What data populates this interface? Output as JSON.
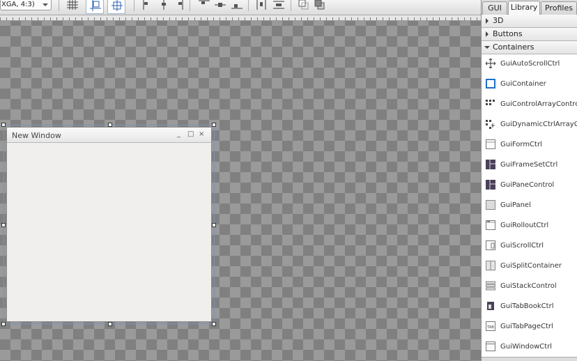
{
  "toolbar": {
    "resolution_value": "XGA, 4:3)",
    "icons": [
      "grid-icon",
      "snap-to-edges-icon",
      "snap-to-centers-icon",
      "align-left-icon",
      "align-center-horizontal-icon",
      "align-right-icon",
      "align-top-icon",
      "align-center-vertical-icon",
      "align-bottom-icon",
      "distribute-horizontal-icon",
      "distribute-vertical-icon",
      "bring-to-front-icon",
      "send-to-back-icon"
    ]
  },
  "canvas": {
    "window": {
      "title": "New Window",
      "controls": [
        "_",
        "□",
        "×"
      ]
    }
  },
  "panel": {
    "tabs": [
      {
        "label": "GUI",
        "active": false
      },
      {
        "label": "Library",
        "active": true
      },
      {
        "label": "Profiles",
        "active": false
      }
    ],
    "categories": [
      {
        "label": "3D",
        "expanded": false
      },
      {
        "label": "Buttons",
        "expanded": false
      },
      {
        "label": "Containers",
        "expanded": true
      }
    ],
    "items": [
      {
        "label": "GuiAutoScrollCtrl",
        "icon": "move-arrows-icon"
      },
      {
        "label": "GuiContainer",
        "icon": "container-box-icon"
      },
      {
        "label": "GuiControlArrayControl",
        "icon": "grid-dots-icon"
      },
      {
        "label": "GuiDynamicCtrlArrayControl",
        "icon": "dynamic-grid-icon"
      },
      {
        "label": "GuiFormCtrl",
        "icon": "form-icon"
      },
      {
        "label": "GuiFrameSetCtrl",
        "icon": "frameset-icon"
      },
      {
        "label": "GuiPaneControl",
        "icon": "pane-icon"
      },
      {
        "label": "GuiPanel",
        "icon": "panel-icon"
      },
      {
        "label": "GuiRolloutCtrl",
        "icon": "rollout-icon"
      },
      {
        "label": "GuiScrollCtrl",
        "icon": "scroll-icon"
      },
      {
        "label": "GuiSplitContainer",
        "icon": "split-icon"
      },
      {
        "label": "GuiStackControl",
        "icon": "stack-icon"
      },
      {
        "label": "GuiTabBookCtrl",
        "icon": "tabbook-icon"
      },
      {
        "label": "GuiTabPageCtrl",
        "icon": "tabpage-icon",
        "badge": "TAB"
      },
      {
        "label": "GuiWindowCtrl",
        "icon": "window-icon"
      }
    ]
  }
}
